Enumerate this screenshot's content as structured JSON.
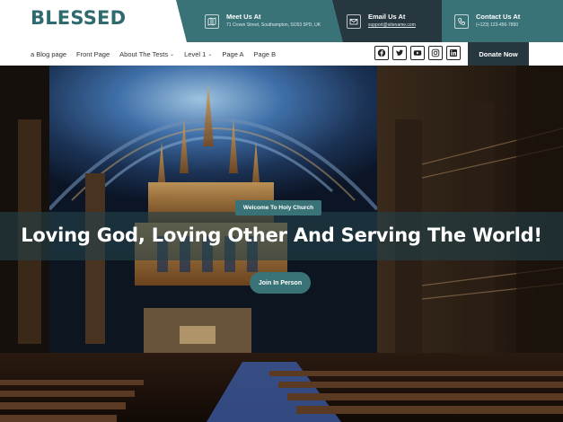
{
  "site": {
    "logo": "BLESSED"
  },
  "header": {
    "meet": {
      "title": "Meet Us At",
      "value": "71 Crown Street, Southampton, SO53 5PD, UK",
      "icon": "map-icon"
    },
    "email": {
      "title": "Email Us At",
      "value": "support@sitename.com",
      "icon": "envelope-icon"
    },
    "contact": {
      "title": "Contact Us At",
      "value": "(+123) 123-456-7890",
      "icon": "phone-icon"
    }
  },
  "nav": {
    "items": [
      {
        "label": "a Blog page"
      },
      {
        "label": "Front Page"
      },
      {
        "label": "About The Tests"
      },
      {
        "label": "Level 1"
      },
      {
        "label": "Page A"
      },
      {
        "label": "Page B"
      }
    ],
    "social": [
      "facebook-icon",
      "twitter-icon",
      "youtube-icon",
      "instagram-icon",
      "linkedin-icon"
    ],
    "donate_label": "Donate Now"
  },
  "hero": {
    "badge": "Welcome To Holy Church",
    "headline": "Loving God, Loving Other And Serving The World!",
    "button": "Join In Person"
  },
  "colors": {
    "brand_teal": "#3a7377",
    "dark_slate": "#26373f",
    "logo_teal": "#2f6a6e"
  }
}
